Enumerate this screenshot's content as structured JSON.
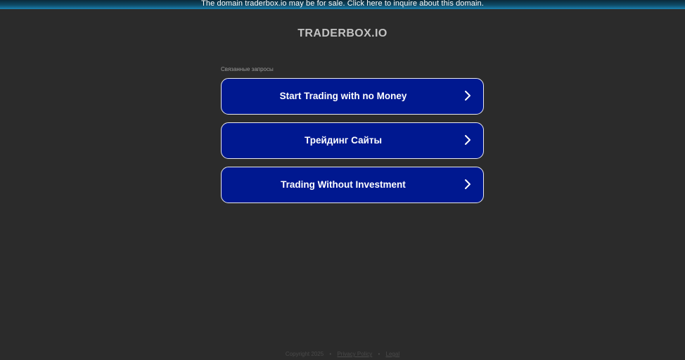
{
  "banner": {
    "text": "The domain traderbox.io may be for sale. Click here to inquire about this domain."
  },
  "site": {
    "title": "TRADERBOX.IO"
  },
  "related": {
    "label": "Связанные запросы",
    "links": [
      {
        "label": "Start Trading with no Money",
        "icon": "chevron-right-icon"
      },
      {
        "label": "Трейдинг Сайты",
        "icon": "chevron-right-icon"
      },
      {
        "label": "Trading Without Investment",
        "icon": "chevron-right-icon"
      }
    ]
  },
  "footer": {
    "copyright": "Copyright 2025",
    "separator": "•",
    "privacy_label": "Privacy Policy",
    "legal_label": "Legal"
  },
  "colors": {
    "background": "#2b2b2b",
    "button_fill": "#001890",
    "button_border": "#e8e8ee",
    "title": "#c2c2c2"
  }
}
